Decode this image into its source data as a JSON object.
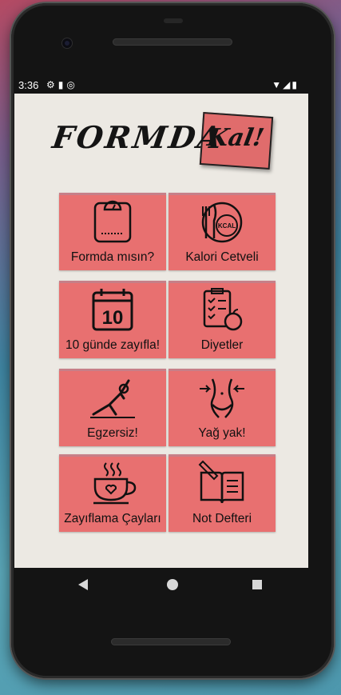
{
  "status_bar": {
    "time": "3:36"
  },
  "logo": {
    "main": "FORMDA",
    "accent": "Kal!"
  },
  "tiles": [
    {
      "label": "Formda mısın?",
      "icon": "scale-icon"
    },
    {
      "label": "Kalori Cetveli",
      "icon": "kcal-plate-icon"
    },
    {
      "label": "10 günde zayıfla!",
      "icon": "calendar-10-icon"
    },
    {
      "label": "Diyetler",
      "icon": "diet-checklist-icon"
    },
    {
      "label": "Egzersiz!",
      "icon": "exercise-icon"
    },
    {
      "label": "Yağ yak!",
      "icon": "waist-icon"
    },
    {
      "label": "Zayıflama Çayları",
      "icon": "tea-cup-icon"
    },
    {
      "label": "Not Defteri",
      "icon": "notebook-icon"
    }
  ],
  "colors": {
    "tile": "#e87070",
    "screen_bg": "#ece9e3"
  },
  "nav": {
    "back_icon": "back-icon",
    "home_icon": "home-icon",
    "recents_icon": "recents-icon"
  }
}
